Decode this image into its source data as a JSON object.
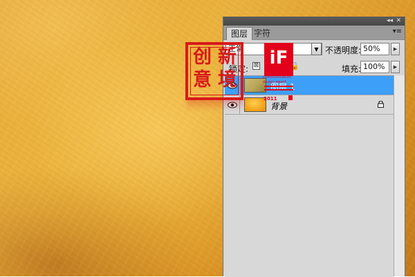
{
  "panel": {
    "tabs": [
      {
        "label": "图层",
        "active": true
      },
      {
        "label": "字符",
        "active": false
      }
    ],
    "blend_mode": "正常",
    "opacity_label": "不透明度:",
    "opacity_value": "50%",
    "lock_label": "锁定:",
    "fill_label": "填充:",
    "fill_value": "100%",
    "layers": [
      {
        "name": "图层 1",
        "selected": true,
        "visible": true,
        "locked": false
      },
      {
        "name": "背景",
        "selected": false,
        "visible": true,
        "locked": true
      }
    ]
  },
  "overlays": {
    "seal_text": [
      "创",
      "新",
      "意",
      "境"
    ],
    "if_logo": "iF",
    "if_subtitle": "communication",
    "if_subtitle2": "design award",
    "if_year": "2011"
  },
  "colors": {
    "canvas": "#e5a63a",
    "selection": "#3d9ff7",
    "seal_red": "#d81a1a",
    "if_red": "#e2001a"
  },
  "icons": {
    "eye": "eye-icon",
    "lock": "lock-icon",
    "panel_menu": "panel-menu-icon",
    "collapse": "collapse-icon"
  }
}
